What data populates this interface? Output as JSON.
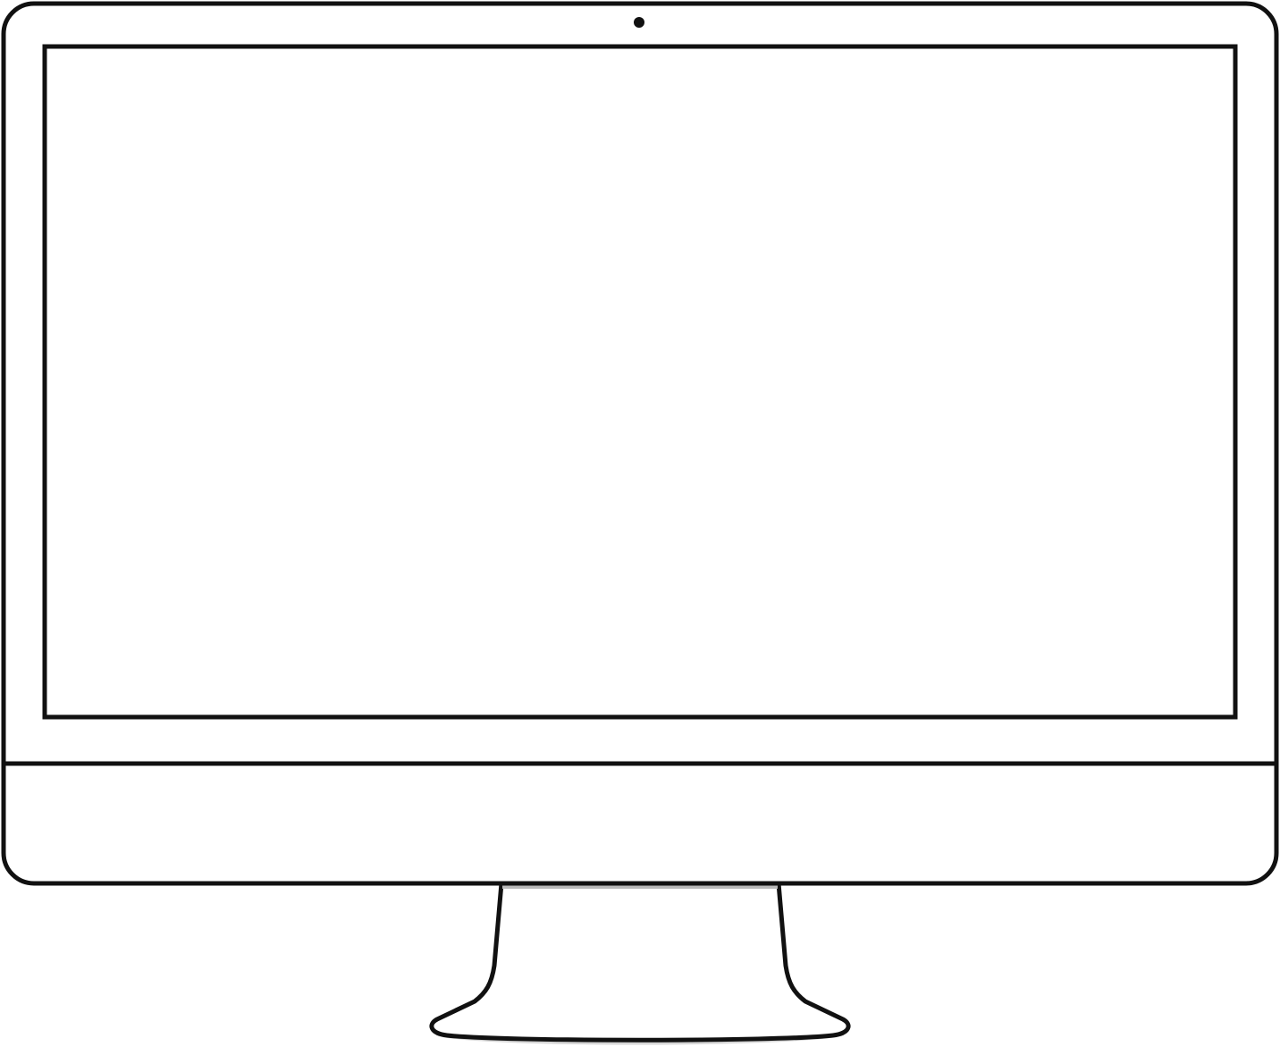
{
  "illustration": {
    "subject": "monitor",
    "icons": [
      "monitor-icon",
      "webcam-icon",
      "stand-icon"
    ]
  },
  "colors": {
    "outline": "#111111",
    "fill": "#ffffff",
    "shadow": "#b8b8b8"
  }
}
